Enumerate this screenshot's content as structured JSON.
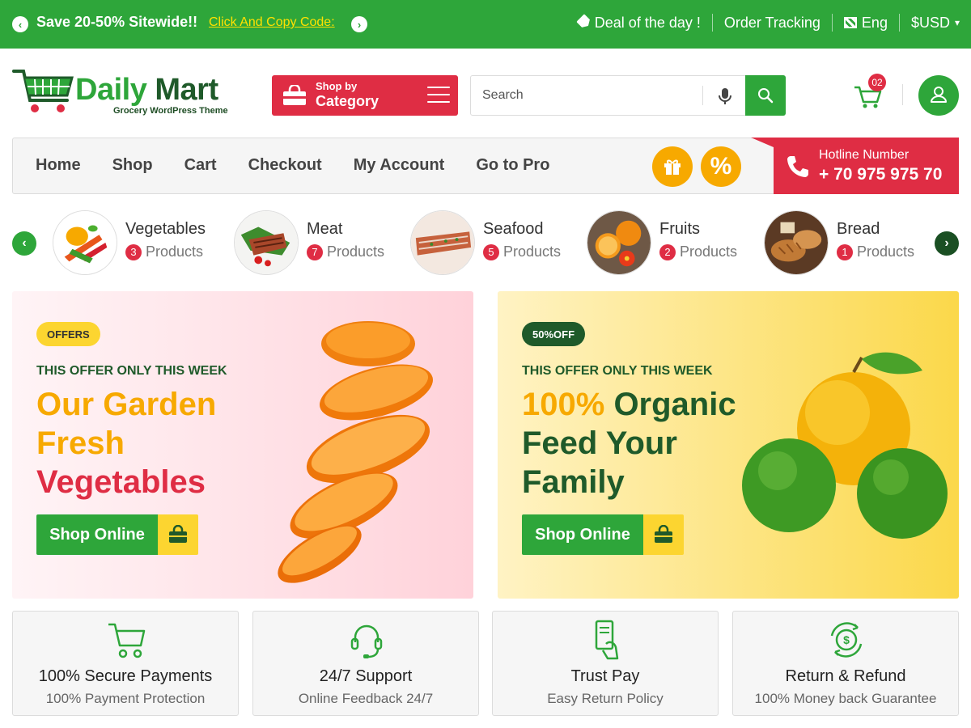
{
  "topbar": {
    "promo": "Save 20-50% Sitewide!!",
    "code_link": "Click And Copy Code:",
    "deal": "Deal of the day !",
    "tracking": "Order Tracking",
    "language": "Eng",
    "currency": "$USD",
    "bg_color": "#2ea63a"
  },
  "logo": {
    "brand_part1": "Daily",
    "brand_part2": "Mart",
    "tagline": "Grocery WordPress Theme"
  },
  "category_button": {
    "small": "Shop by",
    "big": "Category"
  },
  "search": {
    "placeholder": "Search"
  },
  "cart": {
    "count": "02"
  },
  "nav": {
    "links": [
      "Home",
      "Shop",
      "Cart",
      "Checkout",
      "My Account",
      "Go to Pro"
    ],
    "hotline_label": "Hotline Number",
    "hotline_number": "+ 70 975 975 70"
  },
  "categories": [
    {
      "name": "Vegetables",
      "count": "3",
      "suffix": "Products"
    },
    {
      "name": "Meat",
      "count": "7",
      "suffix": "Products"
    },
    {
      "name": "Seafood",
      "count": "5",
      "suffix": "Products"
    },
    {
      "name": "Fruits",
      "count": "2",
      "suffix": "Products"
    },
    {
      "name": "Bread",
      "count": "1",
      "suffix": "Products"
    }
  ],
  "banners": [
    {
      "pill": "OFFERS",
      "kicker": "THIS OFFER ONLY THIS WEEK",
      "line1": "Our Garden",
      "line2": "Fresh",
      "line3": "Vegetables",
      "cta": "Shop Online"
    },
    {
      "pill": "50%OFF",
      "kicker": "THIS OFFER ONLY THIS WEEK",
      "line1a": "100%",
      "line1b": "Organic",
      "line2": "Feed Your",
      "line3": "Family",
      "cta": "Shop Online"
    }
  ],
  "features": [
    {
      "icon": "cart-icon",
      "title": "100% Secure Payments",
      "sub": "100% Payment Protection"
    },
    {
      "icon": "headset-icon",
      "title": "24/7 Support",
      "sub": "Online Feedback 24/7"
    },
    {
      "icon": "card-pay-icon",
      "title": "Trust Pay",
      "sub": "Easy Return Policy"
    },
    {
      "icon": "refund-icon",
      "title": "Return & Refund",
      "sub": "100% Money back Guarantee"
    }
  ],
  "colors": {
    "green": "#2ea63a",
    "dark_green": "#1f5a2a",
    "red": "#df2d44",
    "orange": "#f7a900",
    "yellow": "#fcd530"
  }
}
